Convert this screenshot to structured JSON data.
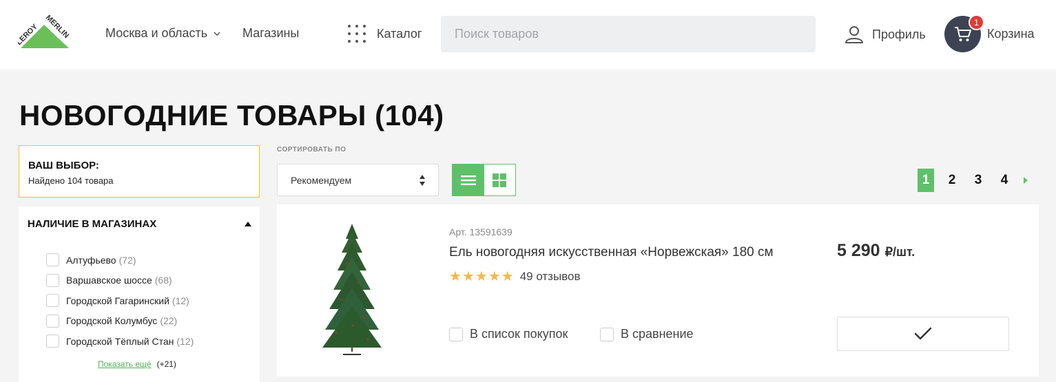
{
  "header": {
    "logo_text": [
      "LEROY",
      "MERLIN"
    ],
    "region_label": "Москва и область",
    "stores_label": "Магазины",
    "catalog_label": "Каталог",
    "search_placeholder": "Поиск товаров",
    "profile_label": "Профиль",
    "cart_label": "Корзина",
    "cart_count": "1"
  },
  "page": {
    "title": "НОВОГОДНИЕ ТОВАРЫ (104)"
  },
  "sidebar": {
    "choice_title": "ВАШ ВЫБОР:",
    "choice_subtitle": "Найдено 104 товара",
    "filter_title": "НАЛИЧИЕ В МАГАЗИНАХ",
    "stores": [
      {
        "name": "Алтуфьево",
        "count": "(72)"
      },
      {
        "name": "Варшавское шоссе",
        "count": "(68)"
      },
      {
        "name": "Городской Гагаринский",
        "count": "(12)"
      },
      {
        "name": "Городской Колумбус",
        "count": "(22)"
      },
      {
        "name": "Городской Тёплый Стан",
        "count": "(12)"
      }
    ],
    "show_more_label": "Показать ещё",
    "show_more_count": "(+21)"
  },
  "sort": {
    "label": "СОРТИРОВАТЬ ПО",
    "value": "Рекомендуем"
  },
  "pagination": {
    "pages": [
      "1",
      "2",
      "3",
      "4"
    ],
    "current": "1"
  },
  "product": {
    "article": "Арт. 13591639",
    "name": "Ель новогодняя искусственная «Норвежская» 180 см",
    "rating_stars": 5,
    "reviews": "49 отзывов",
    "price": "5 290",
    "price_unit": "₽/шт.",
    "shopping_list_label": "В список покупок",
    "compare_label": "В сравнение"
  },
  "colors": {
    "brand_green": "#5fc06a",
    "choice_border": "#f0c419",
    "star": "#f3b94b",
    "cart_circle": "#3d4352",
    "badge": "#e53935"
  }
}
